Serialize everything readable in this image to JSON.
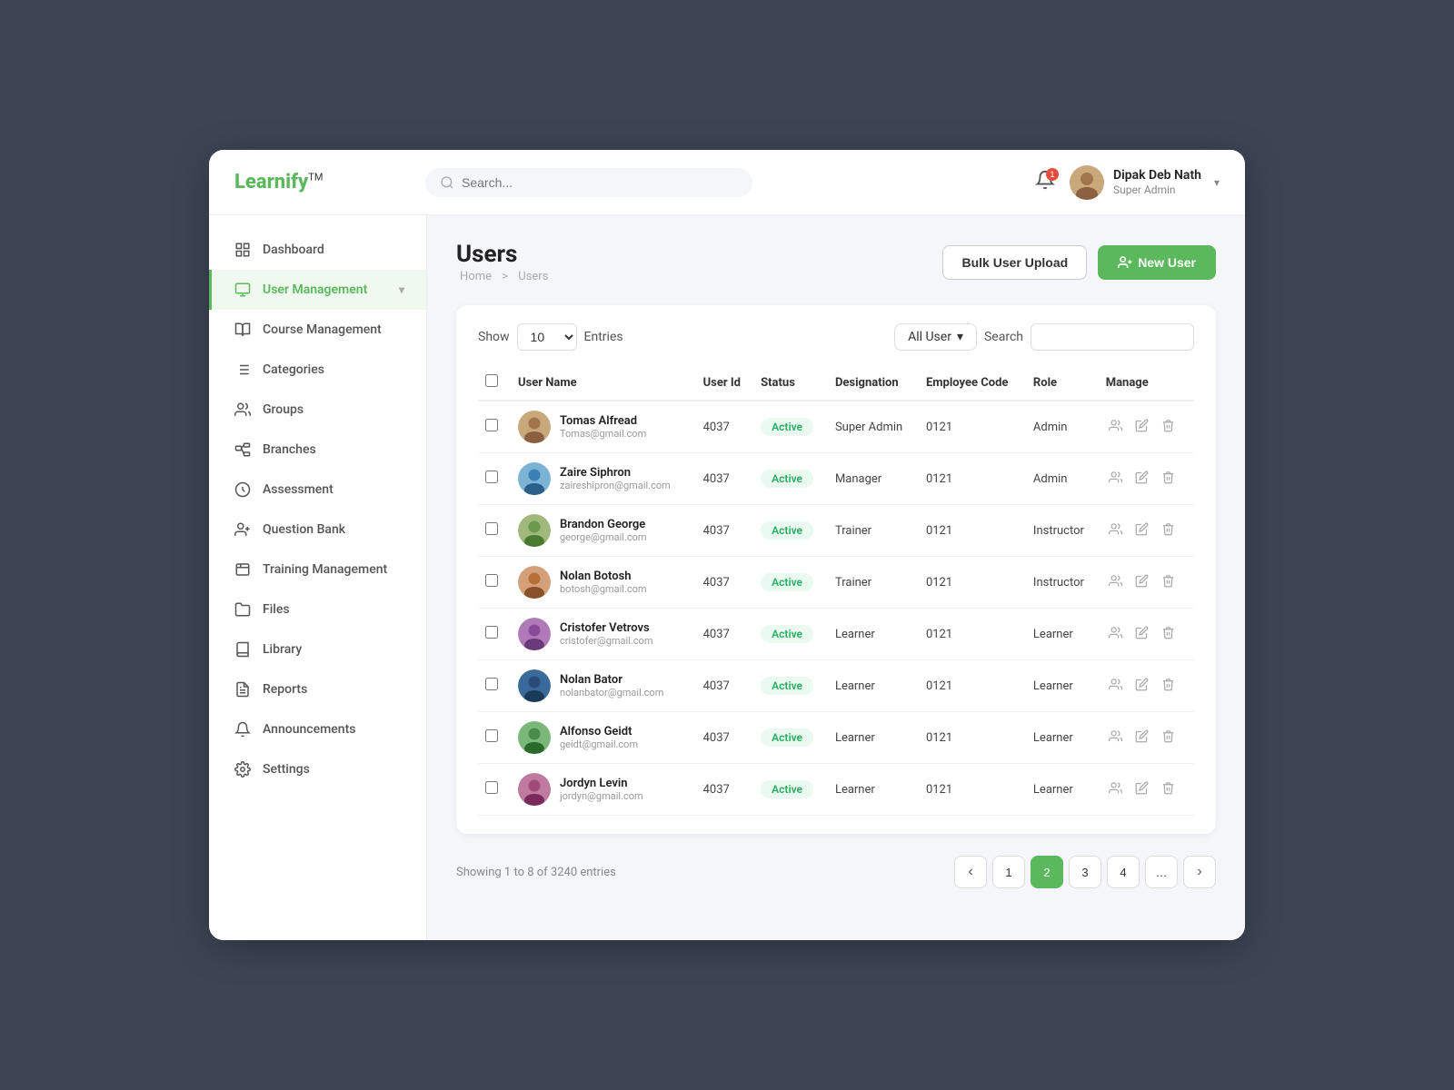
{
  "app": {
    "logo": "Learnify",
    "logo_tm": "TM",
    "search_placeholder": "Search..."
  },
  "header": {
    "notification_count": "1",
    "user_name": "Dipak Deb Nath",
    "user_role": "Super Admin"
  },
  "sidebar": {
    "items": [
      {
        "id": "dashboard",
        "label": "Dashboard",
        "active": false
      },
      {
        "id": "user-management",
        "label": "User Management",
        "active": true,
        "has_arrow": true
      },
      {
        "id": "course-management",
        "label": "Course Management",
        "active": false
      },
      {
        "id": "categories",
        "label": "Categories",
        "active": false
      },
      {
        "id": "groups",
        "label": "Groups",
        "active": false
      },
      {
        "id": "branches",
        "label": "Branches",
        "active": false
      },
      {
        "id": "assessment",
        "label": "Assessment",
        "active": false
      },
      {
        "id": "question-bank",
        "label": "Question Bank",
        "active": false
      },
      {
        "id": "training-management",
        "label": "Training Management",
        "active": false
      },
      {
        "id": "files",
        "label": "Files",
        "active": false
      },
      {
        "id": "library",
        "label": "Library",
        "active": false
      },
      {
        "id": "reports",
        "label": "Reports",
        "active": false
      },
      {
        "id": "announcements",
        "label": "Announcements",
        "active": false
      },
      {
        "id": "settings",
        "label": "Settings",
        "active": false
      }
    ]
  },
  "page": {
    "title": "Users",
    "breadcrumb_home": "Home",
    "breadcrumb_sep": ">",
    "breadcrumb_current": "Users",
    "bulk_upload_label": "Bulk User Upload",
    "new_user_label": "New User",
    "show_label": "Show",
    "entries_value": "10",
    "entries_label": "Entries",
    "filter_label": "All User",
    "search_label": "Search",
    "pagination_info": "Showing 1 to 8 of 3240 entries"
  },
  "table": {
    "columns": [
      "",
      "User Name",
      "User Id",
      "Status",
      "Designation",
      "Employee Code",
      "Role",
      "Manage"
    ],
    "rows": [
      {
        "name": "Tomas Alfread",
        "email": "Tomas@gmail.com",
        "user_id": "4037",
        "status": "Active",
        "designation": "Super Admin",
        "emp_code": "0121",
        "role": "Admin"
      },
      {
        "name": "Zaire Siphron",
        "email": "zaireshipron@gmail.com",
        "user_id": "4037",
        "status": "Active",
        "designation": "Manager",
        "emp_code": "0121",
        "role": "Admin"
      },
      {
        "name": "Brandon George",
        "email": "george@gmail.com",
        "user_id": "4037",
        "status": "Active",
        "designation": "Trainer",
        "emp_code": "0121",
        "role": "Instructor"
      },
      {
        "name": "Nolan Botosh",
        "email": "botosh@gmail.com",
        "user_id": "4037",
        "status": "Active",
        "designation": "Trainer",
        "emp_code": "0121",
        "role": "Instructor"
      },
      {
        "name": "Cristofer Vetrovs",
        "email": "cristofer@gmail.com",
        "user_id": "4037",
        "status": "Active",
        "designation": "Learner",
        "emp_code": "0121",
        "role": "Learner"
      },
      {
        "name": "Nolan Bator",
        "email": "nolanbator@gmail.com",
        "user_id": "4037",
        "status": "Active",
        "designation": "Learner",
        "emp_code": "0121",
        "role": "Learner"
      },
      {
        "name": "Alfonso Geidt",
        "email": "geidt@gmail.com",
        "user_id": "4037",
        "status": "Active",
        "designation": "Learner",
        "emp_code": "0121",
        "role": "Learner"
      },
      {
        "name": "Jordyn Levin",
        "email": "jordyn@gmail.com",
        "user_id": "4037",
        "status": "Active",
        "designation": "Learner",
        "emp_code": "0121",
        "role": "Learner"
      }
    ]
  },
  "pagination": {
    "prev_label": "‹",
    "next_label": "›",
    "pages": [
      "1",
      "2",
      "3",
      "4",
      "…"
    ],
    "active_page": "2"
  },
  "colors": {
    "brand_green": "#5cb85c",
    "active_green": "#5cb85c"
  }
}
